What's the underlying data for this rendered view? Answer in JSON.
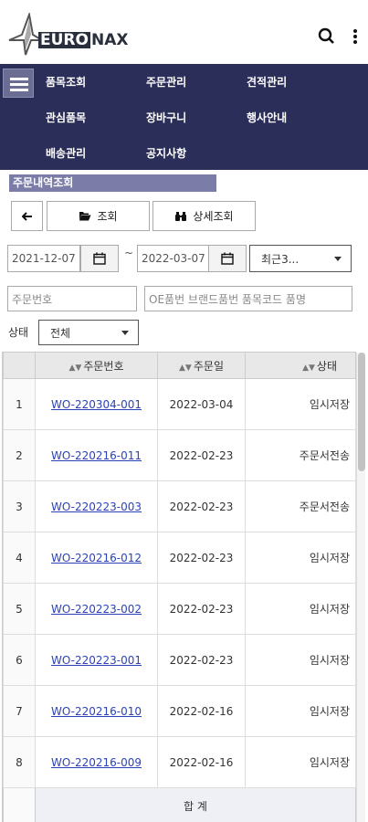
{
  "header": {
    "logo_text_boxed": "EURO",
    "logo_text_plain": "NAX",
    "icons": [
      "search-icon",
      "more-vertical-icon"
    ]
  },
  "nav": {
    "items": [
      {
        "label": "품목조회"
      },
      {
        "label": "주문관리"
      },
      {
        "label": "견적관리"
      },
      {
        "label": "관심품목"
      },
      {
        "label": "장바구니"
      },
      {
        "label": "행사안내"
      },
      {
        "label": "배송관리"
      },
      {
        "label": "공지사항"
      }
    ]
  },
  "page": {
    "section_title": "주문내역조회",
    "back_icon": "arrow-left-icon",
    "search_button": "조회",
    "detail_search_button": "상세조회",
    "date_from": "2021-12-07",
    "date_to": "2022-03-07",
    "tilde": "~",
    "period_select": "최근3...",
    "order_no_placeholder": "주문번호",
    "keyword_placeholder": "OE품번 브랜드품번 품목코드 품명",
    "status_label": "상태",
    "status_select": "전체"
  },
  "table": {
    "headers": [
      "주문번호",
      "주문일",
      "상태"
    ],
    "rows": [
      {
        "no": "1",
        "order": "WO-220304-001",
        "date": "2022-03-04",
        "status": "임시저장"
      },
      {
        "no": "2",
        "order": "WO-220216-011",
        "date": "2022-02-23",
        "status": "주문서전송"
      },
      {
        "no": "3",
        "order": "WO-220223-003",
        "date": "2022-02-23",
        "status": "주문서전송"
      },
      {
        "no": "4",
        "order": "WO-220216-012",
        "date": "2022-02-23",
        "status": "임시저장"
      },
      {
        "no": "5",
        "order": "WO-220223-002",
        "date": "2022-02-23",
        "status": "임시저장"
      },
      {
        "no": "6",
        "order": "WO-220223-001",
        "date": "2022-02-23",
        "status": "임시저장"
      },
      {
        "no": "7",
        "order": "WO-220216-010",
        "date": "2022-02-16",
        "status": "임시저장"
      },
      {
        "no": "8",
        "order": "WO-220216-009",
        "date": "2022-02-16",
        "status": "임시저장"
      }
    ],
    "footer_label": "합 계"
  },
  "colors": {
    "nav_bg": "#2b2e58",
    "section_bg": "#7b7da8",
    "link": "#2a43b8"
  }
}
